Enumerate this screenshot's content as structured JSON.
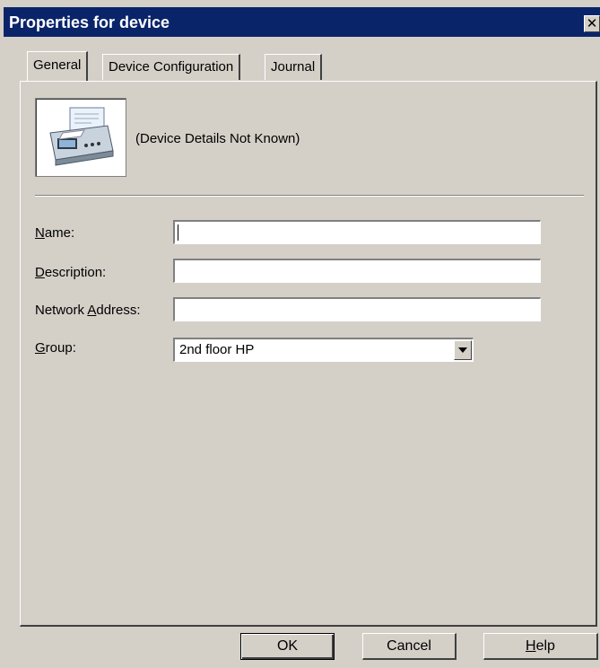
{
  "window": {
    "title": "Properties for  device",
    "close_glyph": "✕"
  },
  "tabs": [
    {
      "label": "General",
      "active": true
    },
    {
      "label": "Device Configuration",
      "active": false
    },
    {
      "label": "Journal",
      "active": false
    }
  ],
  "device": {
    "icon": "fax-printer-icon",
    "details": "(Device Details Not Known)"
  },
  "form": {
    "name": {
      "label_accel": "N",
      "label_rest": "ame:",
      "value": ""
    },
    "description": {
      "label_accel": "D",
      "label_rest": "escription:",
      "value": ""
    },
    "network_address": {
      "label_pre": "Network ",
      "label_accel": "A",
      "label_rest": "ddress:",
      "value": ""
    },
    "group": {
      "label_accel": "G",
      "label_rest": "roup:",
      "value": "2nd floor HP"
    }
  },
  "buttons": {
    "ok": "OK",
    "cancel": "Cancel",
    "help_accel": "H",
    "help_rest": "elp"
  }
}
